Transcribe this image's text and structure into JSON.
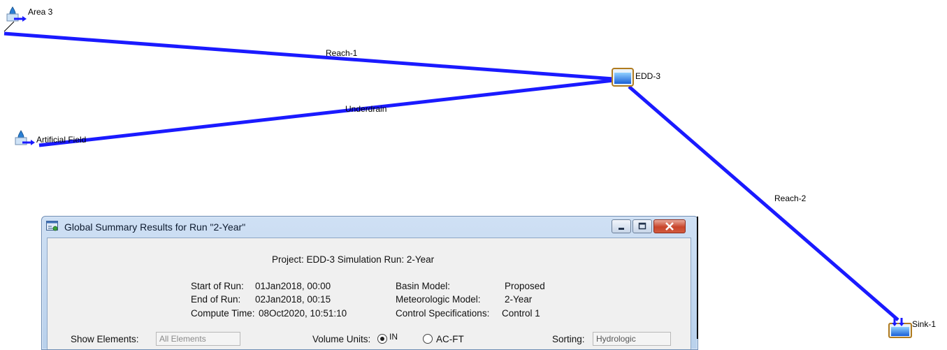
{
  "basin": {
    "nodes": {
      "area3": {
        "label": "Area 3",
        "icon": "subbasin-icon"
      },
      "artificial_field": {
        "label": "Artificial Field",
        "icon": "subbasin-icon"
      },
      "edd3": {
        "label": "EDD-3",
        "icon": "reservoir-icon"
      },
      "sink1": {
        "label": "Sink-1",
        "icon": "sink-icon"
      }
    },
    "reaches": {
      "reach1": {
        "label": "Reach-1"
      },
      "underdrain": {
        "label": "Underdrain"
      },
      "reach2": {
        "label": "Reach-2"
      }
    },
    "link_color": "#1a1aff"
  },
  "dialog": {
    "title": "Global Summary Results for Run \"2-Year\"",
    "project_line": "Project: EDD-3    Simulation Run: 2-Year",
    "start_of_run_label": "Start of Run:",
    "start_of_run_value": "01Jan2018, 00:00",
    "end_of_run_label": "End of Run:",
    "end_of_run_value": "02Jan2018, 00:15",
    "compute_time_label": "Compute Time:",
    "compute_time_value": "08Oct2020, 10:51:10",
    "basin_model_label": "Basin Model:",
    "basin_model_value": "Proposed",
    "met_model_label": "Meteorologic Model:",
    "met_model_value": "2-Year",
    "control_spec_label": "Control Specifications:",
    "control_spec_value": "Control 1",
    "show_elements_label": "Show Elements:",
    "show_elements_value": "All Elements",
    "volume_units_label": "Volume Units:",
    "volume_unit_in": "IN",
    "volume_unit_acft": "AC-FT",
    "sorting_label": "Sorting:",
    "sorting_value": "Hydrologic"
  }
}
